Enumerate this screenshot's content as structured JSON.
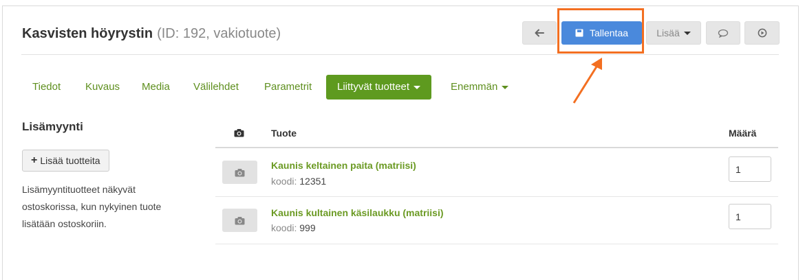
{
  "header": {
    "title": "Kasvisten höyrystin",
    "subtitle": "(ID: 192, vakiotuote)"
  },
  "toolbar": {
    "back_icon": "arrow-left-icon",
    "save_label": "Tallentaa",
    "save_icon": "floppy-disk-icon",
    "more_label": "Lisää",
    "comment_icon": "speech-bubble-icon",
    "preview_icon": "play-circle-icon",
    "highlight_color": "#f36f21",
    "primary_color": "#4a89dc"
  },
  "tabs": [
    {
      "label": "Tiedot"
    },
    {
      "label": "Kuvaus"
    },
    {
      "label": "Media"
    },
    {
      "label": "Välilehdet"
    },
    {
      "label": "Parametrit"
    },
    {
      "label": "Liittyvät tuotteet",
      "active": true
    },
    {
      "label": "Enemmän"
    }
  ],
  "sidebar": {
    "title": "Lisämyynti",
    "add_button": "Lisää tuotteita",
    "help_text": "Lisämyyntituotteet näkyvät ostoskorissa, kun nykyinen tuote lisätään ostoskoriin."
  },
  "table": {
    "col_image_icon": "camera-icon",
    "col_product": "Tuote",
    "col_quantity": "Määrä",
    "code_label": "koodi:",
    "rows": [
      {
        "name": "Kaunis keltainen paita (matriisi)",
        "code": "12351",
        "quantity": "1"
      },
      {
        "name": "Kaunis kultainen käsilaukku (matriisi)",
        "code": "999",
        "quantity": "1"
      }
    ]
  },
  "accent_color": "#5e9a1f"
}
